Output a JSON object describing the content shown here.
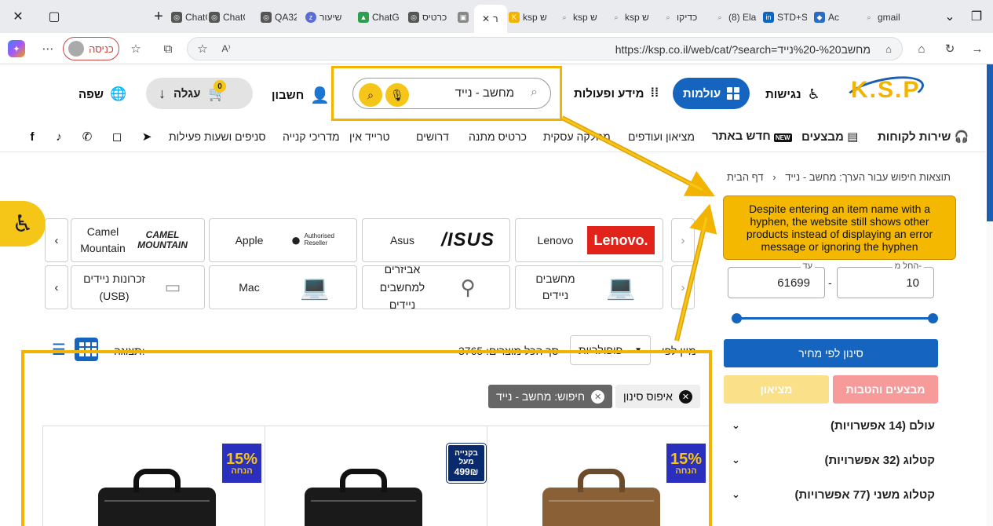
{
  "browser": {
    "tabs": [
      {
        "label": "ChatG",
        "color": "#555"
      },
      {
        "label": "ChatG",
        "color": "#555"
      },
      {
        "label": "QA32",
        "color": "#555"
      },
      {
        "label": "שיעור",
        "color": "#5b6bd9"
      },
      {
        "label": "ChatG",
        "color": "#2e9e4f"
      },
      {
        "label": "כרטיס",
        "color": "#555"
      },
      {
        "label": "ksp ש",
        "color": "#f2b400"
      },
      {
        "label": "ksp ש",
        "color": "#777"
      },
      {
        "label": "ksp ש",
        "color": "#777"
      },
      {
        "label": "כדיקו",
        "color": "#777"
      },
      {
        "label": "(8) Ela",
        "color": "#777"
      },
      {
        "label": "STD+S",
        "color": "#0a66c2"
      },
      {
        "label": "Ac",
        "color": "#2a6cc6"
      },
      {
        "label": "gmail",
        "color": "#777"
      }
    ],
    "active_tab_label": "ר",
    "url": "https://ksp.co.il/web/cat/?search=מחשב%20-%20נייד",
    "login_label": "כניסה"
  },
  "header": {
    "logo": "K.S.P",
    "accessibility_label": "נגישות",
    "world_label": "עולמות",
    "info_label": "מידע ופעולות",
    "search_value": "מחשב - נייד",
    "account_label": "חשבון",
    "cart_label": "עגלה",
    "cart_count": "0",
    "language_label": "שפה"
  },
  "nav": {
    "customer_service": "שירות לקוחות",
    "deals": "מבצעים",
    "new_on_site": "חדש באתר",
    "new_badge": "NEW",
    "items": [
      "מציאון ועודפים",
      "מחלקה עסקית",
      "כרטיס מתנה",
      "דרושים",
      "טרייד אין",
      "מדריכי קנייה",
      "סניפים ושעות פעילות"
    ]
  },
  "breadcrumb": {
    "home": "דף הבית",
    "current": "תוצאות חיפוש עבור הערך: מחשב - נייד"
  },
  "brands": [
    {
      "name": "Lenovo",
      "logo_text": "Lenovo."
    },
    {
      "name": "Asus",
      "logo_text": "/ISUS"
    },
    {
      "name": "Apple",
      "logo_text": "Authorised Reseller"
    },
    {
      "name": "Camel Mountain",
      "logo_text": "CAMEL MOUNTAIN"
    }
  ],
  "categories": [
    {
      "name": "מחשבים ניידים",
      "icon": "laptop-icon"
    },
    {
      "name": "אביזרים למחשבים ניידים",
      "icon": "cable-lock-icon"
    },
    {
      "name": "Mac",
      "icon": "macbook-icon"
    },
    {
      "name": "זכרונות ניידים (USB)",
      "icon": "usb-drive-icon"
    }
  ],
  "results": {
    "sort_label": "מיין לפי",
    "sort_value": "פופולריות",
    "total_label": "סך הכל מוצרים: 3765",
    "view_label": "תצוגה:",
    "reset_filter": "איפוס סינון",
    "search_chip": "חיפוש: מחשב - נייד"
  },
  "products": [
    {
      "badge_type": "discount",
      "badge_value": "15%",
      "badge_text": "הנחה",
      "bag_color": "#8a6036"
    },
    {
      "badge_type": "sale",
      "badge_line1": "בקנייה",
      "badge_line2": "מעל",
      "badge_value": "499₪",
      "bag_color": "#1a1a1a"
    },
    {
      "badge_type": "discount",
      "badge_value": "15%",
      "badge_text": "הנחה",
      "bag_color": "#1a1a1a"
    }
  ],
  "sidebar": {
    "annotation": "Despite entering an item name with a hyphen, the website still shows other products instead of displaying an error message or ignoring the hyphen",
    "price_from_label": "החל מ-",
    "price_from": "10",
    "price_to_label": "עד",
    "price_to": "61699",
    "price_sep": "-",
    "filter_price": "סינון לפי מחיר",
    "deals_button": "מבצעים והטבות",
    "bargain_button": "מציאון",
    "accordion": [
      "עולם (14 אפשרויות)",
      "קטלוג (32 אפשרויות)",
      "קטלוג משני (77 אפשרויות)"
    ]
  },
  "colors": {
    "brand_blue": "#1565c0",
    "brand_yellow": "#f5c518",
    "annotation": "#f2b400"
  }
}
